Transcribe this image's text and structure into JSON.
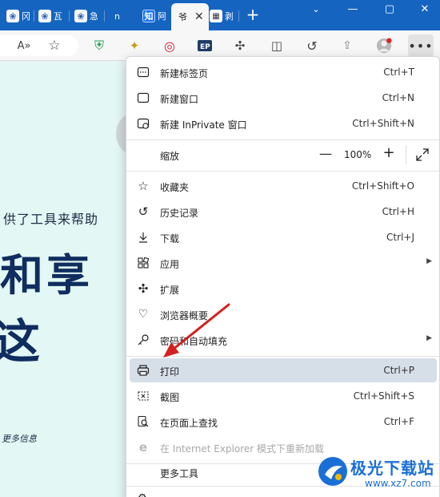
{
  "tabs": [
    {
      "favicon": "paw-icon",
      "label": "冈"
    },
    {
      "favicon": "paw-icon",
      "label": "瓦"
    },
    {
      "favicon": "paw-icon",
      "label": "急"
    },
    {
      "favicon": "",
      "label": "n"
    },
    {
      "favicon": "zhi-icon",
      "favicon_text": "知",
      "label": "阿"
    },
    {
      "favicon": "",
      "label": "爷",
      "active": true
    },
    {
      "favicon": "calendar-icon",
      "label": "剥"
    }
  ],
  "menu": {
    "items": [
      {
        "icon": "new-tab-icon",
        "label": "新建标签页",
        "shortcut": "Ctrl+T"
      },
      {
        "icon": "new-window-icon",
        "label": "新建窗口",
        "shortcut": "Ctrl+N"
      },
      {
        "icon": "inprivate-icon",
        "label": "新建 InPrivate 窗口",
        "shortcut": "Ctrl+Shift+N"
      },
      {
        "icon": "favorites-icon",
        "label": "收藏夹",
        "shortcut": "Ctrl+Shift+O"
      },
      {
        "icon": "history-icon",
        "label": "历史记录",
        "shortcut": "Ctrl+H"
      },
      {
        "icon": "download-icon",
        "label": "下载",
        "shortcut": "Ctrl+J"
      },
      {
        "icon": "apps-icon",
        "label": "应用",
        "shortcut": ""
      },
      {
        "icon": "extensions-icon",
        "label": "扩展",
        "shortcut": ""
      },
      {
        "icon": "browser-essentials-icon",
        "label": "浏览器概要",
        "shortcut": ""
      },
      {
        "icon": "key-icon",
        "label": "密码和自动填充",
        "shortcut": ""
      },
      {
        "icon": "print-icon",
        "label": "打印",
        "shortcut": "Ctrl+P"
      },
      {
        "icon": "screenshot-icon",
        "label": "截图",
        "shortcut": "Ctrl+Shift+S"
      },
      {
        "icon": "find-icon",
        "label": "在页面上查找",
        "shortcut": "Ctrl+F"
      },
      {
        "icon": "ie-icon",
        "label": "在 Internet Explorer 模式下重新加载",
        "shortcut": ""
      },
      {
        "icon": "",
        "label": "更多工具",
        "shortcut": ""
      }
    ],
    "zoom": {
      "label": "缩放",
      "value": "100%",
      "minus": "—",
      "plus": "+"
    }
  },
  "page": {
    "subtitle": "供了工具来帮助",
    "headline": "和享",
    "headline2": "这",
    "more_info": "更多信息"
  },
  "watermark": {
    "brand": "极光下载站",
    "url": "www.xz7.com"
  },
  "colors": {
    "tabbar": "#1565c0",
    "highlight": "#d6dee8",
    "arrow": "#d42020",
    "brand": "#1a6fd6"
  }
}
